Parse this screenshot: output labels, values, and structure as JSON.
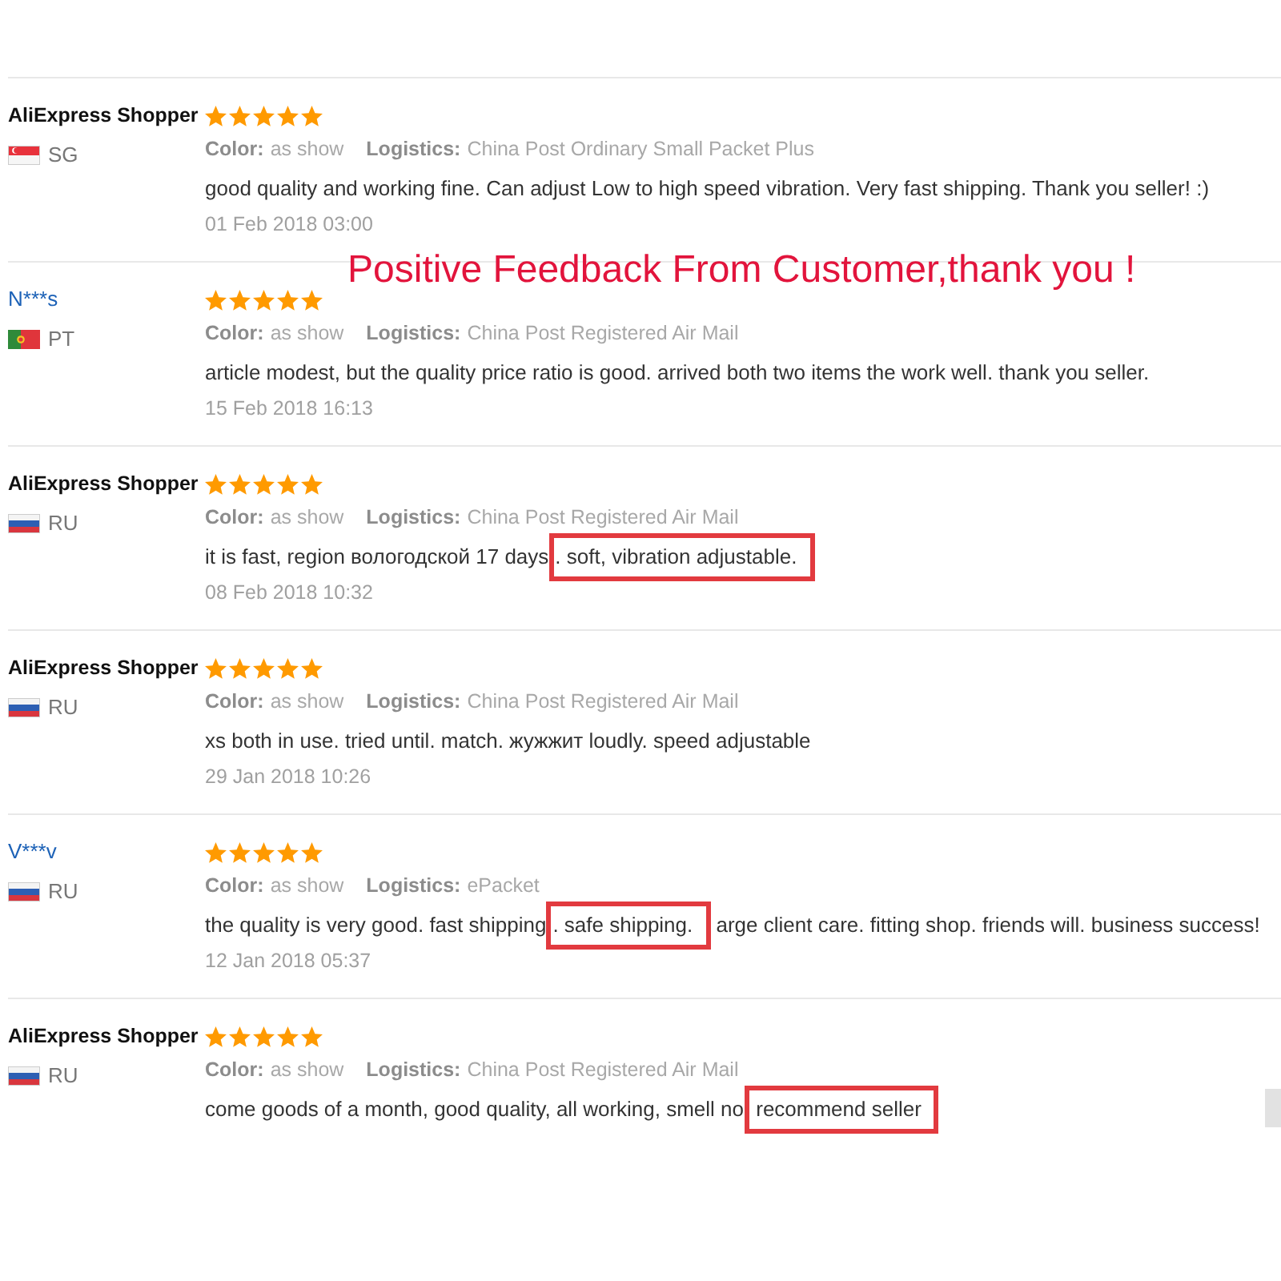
{
  "banner": {
    "text": "Positive Feedback From Customer,thank you !"
  },
  "reviews": [
    {
      "name": "AliExpress Shopper",
      "linked": false,
      "flag": {
        "kind": "sg"
      },
      "country": "SG",
      "stars": 5,
      "attributes": [
        {
          "label": "Color:",
          "value": "as show"
        },
        {
          "label": "Logistics:",
          "value": "China Post Ordinary Small Packet Plus"
        }
      ],
      "text_parts": [
        {
          "text": "good quality and working fine. Can adjust Low to high speed vibration. Very fast shipping. Thank you seller! :)",
          "highlighted": false
        }
      ],
      "date": "01 Feb 2018 03:00"
    },
    {
      "name": "N***s",
      "linked": true,
      "flag": {
        "kind": "pt"
      },
      "country": "PT",
      "stars": 5,
      "attributes": [
        {
          "label": "Color:",
          "value": "as show"
        },
        {
          "label": "Logistics:",
          "value": "China Post Registered Air Mail"
        }
      ],
      "text_parts": [
        {
          "text": "article modest, but the quality price ratio is good. arrived both two items the work well. thank you seller.",
          "highlighted": false
        }
      ],
      "date": "15 Feb 2018 16:13"
    },
    {
      "name": "AliExpress Shopper",
      "linked": false,
      "flag": {
        "kind": "ru"
      },
      "country": "RU",
      "stars": 5,
      "attributes": [
        {
          "label": "Color:",
          "value": "as show"
        },
        {
          "label": "Logistics:",
          "value": "China Post Registered Air Mail"
        }
      ],
      "text_parts": [
        {
          "text": "it is fast, region вологодской 17 days",
          "highlighted": false
        },
        {
          "text": ". soft, vibration adjustable.",
          "highlighted": true
        }
      ],
      "date": "08 Feb 2018 10:32"
    },
    {
      "name": "AliExpress Shopper",
      "linked": false,
      "flag": {
        "kind": "ru"
      },
      "country": "RU",
      "stars": 5,
      "attributes": [
        {
          "label": "Color:",
          "value": "as show"
        },
        {
          "label": "Logistics:",
          "value": "China Post Registered Air Mail"
        }
      ],
      "text_parts": [
        {
          "text": "xs both in use. tried until. match. жужжит loudly. speed adjustable",
          "highlighted": false
        }
      ],
      "date": "29 Jan 2018 10:26"
    },
    {
      "name": "V***v",
      "linked": true,
      "flag": {
        "kind": "ru"
      },
      "country": "RU",
      "stars": 5,
      "attributes": [
        {
          "label": "Color:",
          "value": "as show"
        },
        {
          "label": "Logistics:",
          "value": "ePacket"
        }
      ],
      "text_parts": [
        {
          "text": "the quality is very good. fast shipping",
          "highlighted": false
        },
        {
          "text": ". safe shipping.",
          "highlighted": true
        },
        {
          "text": " arge client care. fitting shop. friends will. business success!",
          "highlighted": false
        }
      ],
      "date": "12 Jan 2018 05:37"
    },
    {
      "name": "AliExpress Shopper",
      "linked": false,
      "flag": {
        "kind": "ru"
      },
      "country": "RU",
      "stars": 5,
      "attributes": [
        {
          "label": "Color:",
          "value": "as show"
        },
        {
          "label": "Logistics:",
          "value": "China Post Registered Air Mail"
        }
      ],
      "text_parts": [
        {
          "text": "come goods of a month, good quality, all working, smell no",
          "highlighted": false
        },
        {
          "text": " recommend seller",
          "highlighted": true
        }
      ]
    }
  ]
}
